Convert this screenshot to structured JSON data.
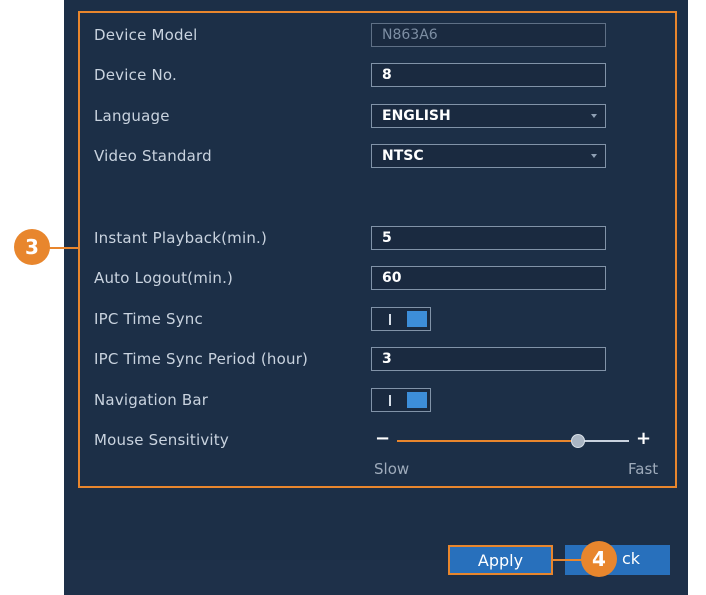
{
  "settings": {
    "rows": [
      {
        "label": "Device Model",
        "value": "N863A6"
      },
      {
        "label": "Device No.",
        "value": "8"
      },
      {
        "label": "Language",
        "value": "ENGLISH"
      },
      {
        "label": "Video Standard",
        "value": "NTSC"
      },
      {
        "label": "Instant Playback(min.)",
        "value": "5"
      },
      {
        "label": "Auto Logout(min.)",
        "value": "60"
      },
      {
        "label": "IPC Time Sync",
        "value": ""
      },
      {
        "label": "IPC Time Sync Period (hour)",
        "value": "3"
      },
      {
        "label": "Navigation Bar",
        "value": ""
      },
      {
        "label": "Mouse Sensitivity",
        "value": ""
      }
    ],
    "toggles": {
      "ipc_time_sync": true,
      "navigation_bar": true
    },
    "mouse_sensitivity": {
      "level": 0.78,
      "min_sign": "−",
      "max_sign": "+",
      "min_label": "Slow",
      "max_label": "Fast"
    }
  },
  "buttons": {
    "apply_label": "Apply",
    "back_label": "ck"
  },
  "callouts": {
    "step3": "3",
    "step4": "4"
  },
  "colors": {
    "panel": "#1c2f47",
    "accent": "#e8862d",
    "button": "#2870bc",
    "toggle_on": "#3d8ed9"
  }
}
